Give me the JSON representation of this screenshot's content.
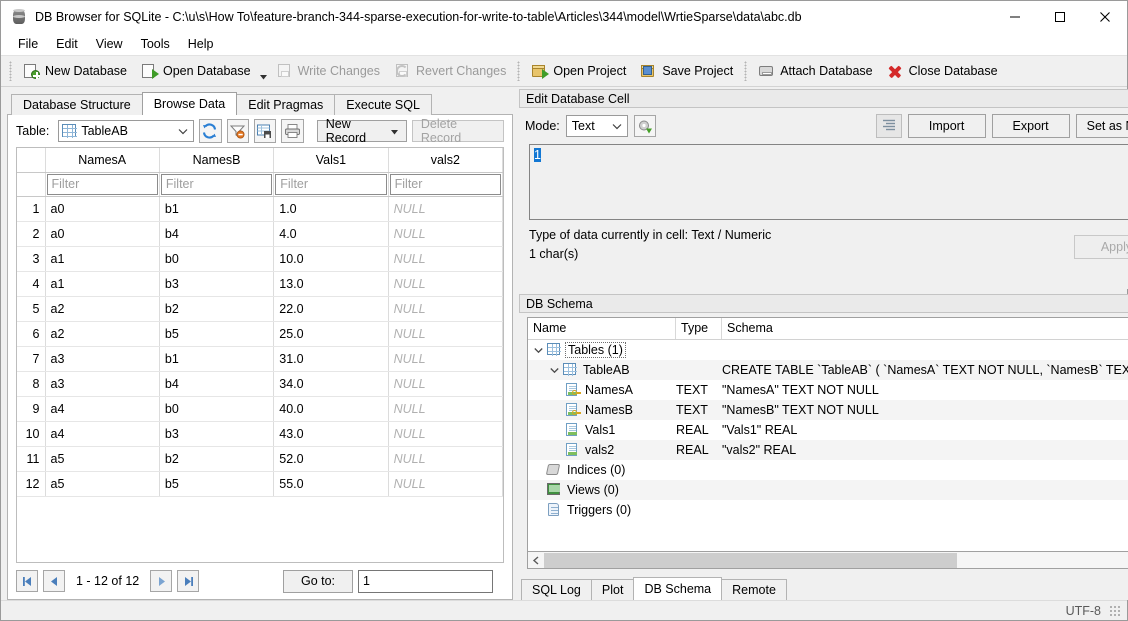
{
  "window": {
    "title": "DB Browser for SQLite - C:\\u\\s\\How To\\feature-branch-344-sparse-execution-for-write-to-table\\Articles\\344\\model\\WrtieSparse\\data\\abc.db",
    "app_icon": "database-icon",
    "minimize_label": "Minimize",
    "maximize_label": "Maximize",
    "close_label": "Close"
  },
  "menubar": {
    "items": [
      {
        "label": "File"
      },
      {
        "label": "Edit"
      },
      {
        "label": "View"
      },
      {
        "label": "Tools"
      },
      {
        "label": "Help"
      }
    ]
  },
  "toolbar": {
    "buttons": [
      {
        "label": "New Database",
        "icon": "new-database-icon",
        "enabled": true
      },
      {
        "label": "Open Database",
        "icon": "open-database-icon",
        "enabled": true,
        "has_dropdown": true
      },
      {
        "label": "Write Changes",
        "icon": "write-changes-icon",
        "enabled": false
      },
      {
        "label": "Revert Changes",
        "icon": "revert-changes-icon",
        "enabled": false
      },
      {
        "label": "Open Project",
        "icon": "open-project-icon",
        "enabled": true
      },
      {
        "label": "Save Project",
        "icon": "save-project-icon",
        "enabled": true
      },
      {
        "label": "Attach Database",
        "icon": "attach-database-icon",
        "enabled": true
      },
      {
        "label": "Close Database",
        "icon": "close-database-icon",
        "enabled": true
      }
    ]
  },
  "main_tabs": [
    {
      "label": "Database Structure",
      "active": false
    },
    {
      "label": "Browse Data",
      "active": true
    },
    {
      "label": "Edit Pragmas",
      "active": false
    },
    {
      "label": "Execute SQL",
      "active": false
    }
  ],
  "browse_data": {
    "table_label": "Table:",
    "table_selected": "TableAB",
    "table_icon": "table-grid-icon",
    "tool_icons": [
      {
        "name": "refresh-icon"
      },
      {
        "name": "clear-filters-icon"
      },
      {
        "name": "save-results-icon"
      },
      {
        "name": "print-icon"
      }
    ],
    "new_record_label": "New Record",
    "delete_record_label": "Delete Record",
    "delete_record_enabled": false,
    "filter_placeholder": "Filter",
    "columns": [
      "NamesA",
      "NamesB",
      "Vals1",
      "vals2"
    ],
    "rows": [
      {
        "n": "1",
        "cells": [
          "a0",
          "b1",
          "1.0",
          "NULL"
        ]
      },
      {
        "n": "2",
        "cells": [
          "a0",
          "b4",
          "4.0",
          "NULL"
        ]
      },
      {
        "n": "3",
        "cells": [
          "a1",
          "b0",
          "10.0",
          "NULL"
        ]
      },
      {
        "n": "4",
        "cells": [
          "a1",
          "b3",
          "13.0",
          "NULL"
        ]
      },
      {
        "n": "5",
        "cells": [
          "a2",
          "b2",
          "22.0",
          "NULL"
        ]
      },
      {
        "n": "6",
        "cells": [
          "a2",
          "b5",
          "25.0",
          "NULL"
        ]
      },
      {
        "n": "7",
        "cells": [
          "a3",
          "b1",
          "31.0",
          "NULL"
        ]
      },
      {
        "n": "8",
        "cells": [
          "a3",
          "b4",
          "34.0",
          "NULL"
        ]
      },
      {
        "n": "9",
        "cells": [
          "a4",
          "b0",
          "40.0",
          "NULL"
        ]
      },
      {
        "n": "10",
        "cells": [
          "a4",
          "b3",
          "43.0",
          "NULL"
        ]
      },
      {
        "n": "11",
        "cells": [
          "a5",
          "b2",
          "52.0",
          "NULL"
        ]
      },
      {
        "n": "12",
        "cells": [
          "a5",
          "b5",
          "55.0",
          "NULL"
        ]
      }
    ],
    "pager": {
      "first_label": "First page",
      "prev_label": "Previous page",
      "range_text": "1 - 12 of 12",
      "next_label": "Next page",
      "last_label": "Last page",
      "goto_label": "Go to:",
      "goto_value": "1"
    }
  },
  "edit_cell": {
    "panel_title": "Edit Database Cell",
    "mode_label": "Mode:",
    "mode_value": "Text",
    "apply_mode_icon": "apply-mode-icon",
    "word_wrap_icon": "word-wrap-icon",
    "import_label": "Import",
    "export_label": "Export",
    "set_null_label": "Set as NULL",
    "content": "1",
    "type_info": "Type of data currently in cell: Text / Numeric",
    "size_info": "1 char(s)",
    "apply_label": "Apply",
    "apply_enabled": false,
    "float_icon": "float-panel-icon",
    "close_icon": "close-panel-icon"
  },
  "db_schema": {
    "panel_title": "DB Schema",
    "float_icon": "float-panel-icon",
    "close_icon": "close-panel-icon",
    "headers": [
      "Name",
      "Type",
      "Schema"
    ],
    "tree": [
      {
        "name": "Tables (1)",
        "type": "",
        "schema": "",
        "indent": 0,
        "icon": "tables-group-icon",
        "expanded": true,
        "selected": true
      },
      {
        "name": "TableAB",
        "type": "",
        "schema": "CREATE TABLE `TableAB` ( `NamesA` TEXT NOT NULL, `NamesB` TEXT NOT",
        "indent": 1,
        "icon": "table-icon",
        "expanded": true
      },
      {
        "name": "NamesA",
        "type": "TEXT",
        "schema": "\"NamesA\" TEXT NOT NULL",
        "indent": 2,
        "icon": "column-key-icon"
      },
      {
        "name": "NamesB",
        "type": "TEXT",
        "schema": "\"NamesB\" TEXT NOT NULL",
        "indent": 2,
        "icon": "column-key-icon"
      },
      {
        "name": "Vals1",
        "type": "REAL",
        "schema": "\"Vals1\" REAL",
        "indent": 2,
        "icon": "column-icon"
      },
      {
        "name": "vals2",
        "type": "REAL",
        "schema": "\"vals2\" REAL",
        "indent": 2,
        "icon": "column-icon"
      },
      {
        "name": "Indices (0)",
        "type": "",
        "schema": "",
        "indent": 0,
        "icon": "indices-icon"
      },
      {
        "name": "Views (0)",
        "type": "",
        "schema": "",
        "indent": 0,
        "icon": "views-icon"
      },
      {
        "name": "Triggers (0)",
        "type": "",
        "schema": "",
        "indent": 0,
        "icon": "triggers-icon"
      }
    ]
  },
  "bottom_tabs": [
    {
      "label": "SQL Log",
      "active": false
    },
    {
      "label": "Plot",
      "active": false
    },
    {
      "label": "DB Schema",
      "active": true
    },
    {
      "label": "Remote",
      "active": false
    }
  ],
  "statusbar": {
    "encoding": "UTF-8"
  },
  "colors": {
    "accent_selection": "#1277d3",
    "window_bg": "#f0f0f0",
    "panel_bg": "#ffffff",
    "null_text": "#b0b0b0",
    "disabled_text": "#9a9a9a"
  }
}
